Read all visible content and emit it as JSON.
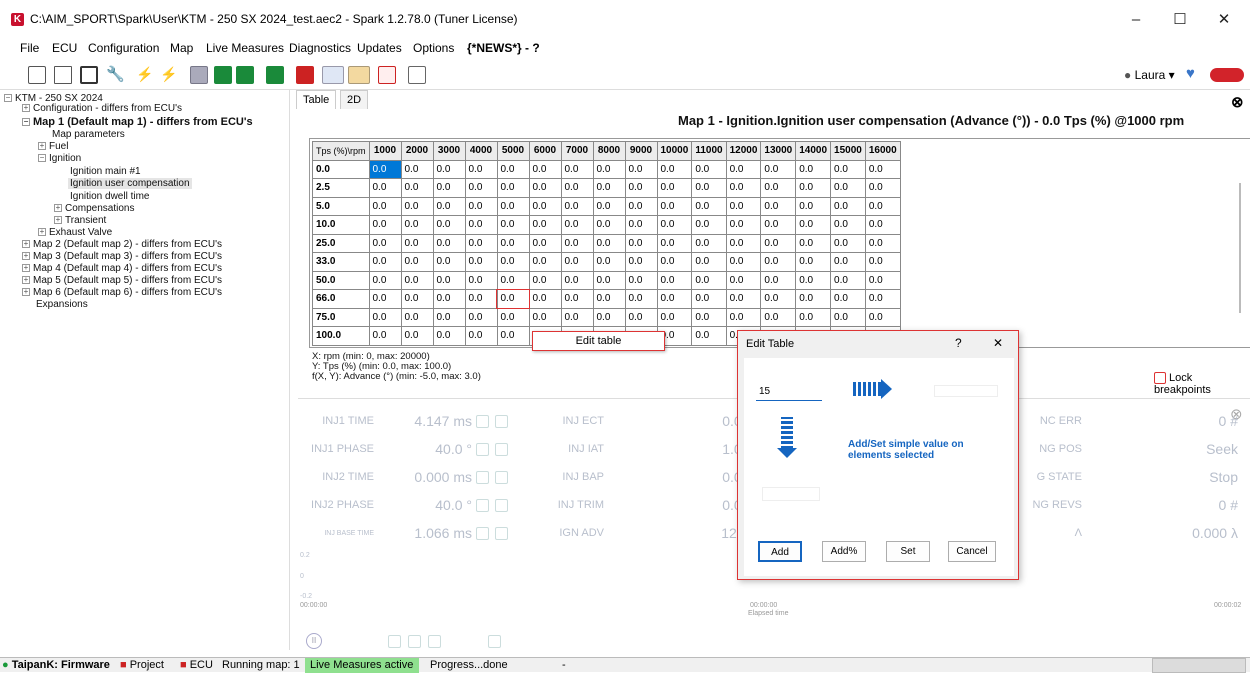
{
  "window": {
    "title": "C:\\AIM_SPORT\\Spark\\User\\KTM - 250 SX 2024_test.aec2 - Spark 1.2.78.0 (Tuner License)",
    "logo_letter": "K"
  },
  "menu": [
    "File",
    "ECU",
    "Configuration",
    "Map",
    "Live Measures",
    "Diagnostics",
    "Updates",
    "Options",
    "{*NEWS*} - ?"
  ],
  "user": {
    "name": "Laura"
  },
  "tree": [
    {
      "label": "KTM - 250 SX 2024",
      "expander": "−",
      "bold": false
    },
    {
      "label": "Configuration - differs from ECU's",
      "expander": "+",
      "bold": false
    },
    {
      "label": "Map 1 (Default map 1) - differs from ECU's",
      "expander": "−",
      "bold": true
    },
    {
      "label": "Map parameters",
      "expander": "",
      "bold": false
    },
    {
      "label": "Fuel",
      "expander": "+",
      "bold": false
    },
    {
      "label": "Ignition",
      "expander": "−",
      "bold": false
    },
    {
      "label": "Ignition main #1",
      "expander": "",
      "bold": false
    },
    {
      "label": "Ignition user compensation",
      "expander": "",
      "bold": false
    },
    {
      "label": "Ignition dwell time",
      "expander": "",
      "bold": false
    },
    {
      "label": "Compensations",
      "expander": "+",
      "bold": false
    },
    {
      "label": "Transient",
      "expander": "+",
      "bold": false
    },
    {
      "label": "Exhaust Valve",
      "expander": "+",
      "bold": false
    },
    {
      "label": "Map 2 (Default map 2) - differs from ECU's",
      "expander": "+",
      "bold": false
    },
    {
      "label": "Map 3 (Default map 3) - differs from ECU's",
      "expander": "+",
      "bold": false
    },
    {
      "label": "Map 4 (Default map 4) - differs from ECU's",
      "expander": "+",
      "bold": false
    },
    {
      "label": "Map 5 (Default map 5) - differs from ECU's",
      "expander": "+",
      "bold": false
    },
    {
      "label": "Map 6 (Default map 6) - differs from ECU's",
      "expander": "+",
      "bold": false
    },
    {
      "label": "Expansions",
      "expander": "",
      "bold": false
    }
  ],
  "tabs": [
    "Table",
    "2D"
  ],
  "map_title": "Map 1  -  Ignition.Ignition user compensation (Advance (°))  -  0.0 Tps (%) @1000 rpm",
  "table": {
    "corner": "Tps (%)\\rpm",
    "columns": [
      "1000",
      "2000",
      "3000",
      "4000",
      "5000",
      "6000",
      "7000",
      "8000",
      "9000",
      "10000",
      "11000",
      "12000",
      "13000",
      "14000",
      "15000",
      "16000"
    ],
    "rows": [
      {
        "label": "0.0",
        "cells": [
          "0.0",
          "0.0",
          "0.0",
          "0.0",
          "0.0",
          "0.0",
          "0.0",
          "0.0",
          "0.0",
          "0.0",
          "0.0",
          "0.0",
          "0.0",
          "0.0",
          "0.0",
          "0.0"
        ]
      },
      {
        "label": "2.5",
        "cells": [
          "0.0",
          "0.0",
          "0.0",
          "0.0",
          "0.0",
          "0.0",
          "0.0",
          "0.0",
          "0.0",
          "0.0",
          "0.0",
          "0.0",
          "0.0",
          "0.0",
          "0.0",
          "0.0"
        ]
      },
      {
        "label": "5.0",
        "cells": [
          "0.0",
          "0.0",
          "0.0",
          "0.0",
          "0.0",
          "0.0",
          "0.0",
          "0.0",
          "0.0",
          "0.0",
          "0.0",
          "0.0",
          "0.0",
          "0.0",
          "0.0",
          "0.0"
        ]
      },
      {
        "label": "10.0",
        "cells": [
          "0.0",
          "0.0",
          "0.0",
          "0.0",
          "0.0",
          "0.0",
          "0.0",
          "0.0",
          "0.0",
          "0.0",
          "0.0",
          "0.0",
          "0.0",
          "0.0",
          "0.0",
          "0.0"
        ]
      },
      {
        "label": "25.0",
        "cells": [
          "0.0",
          "0.0",
          "0.0",
          "0.0",
          "0.0",
          "0.0",
          "0.0",
          "0.0",
          "0.0",
          "0.0",
          "0.0",
          "0.0",
          "0.0",
          "0.0",
          "0.0",
          "0.0"
        ]
      },
      {
        "label": "33.0",
        "cells": [
          "0.0",
          "0.0",
          "0.0",
          "0.0",
          "0.0",
          "0.0",
          "0.0",
          "0.0",
          "0.0",
          "0.0",
          "0.0",
          "0.0",
          "0.0",
          "0.0",
          "0.0",
          "0.0"
        ]
      },
      {
        "label": "50.0",
        "cells": [
          "0.0",
          "0.0",
          "0.0",
          "0.0",
          "0.0",
          "0.0",
          "0.0",
          "0.0",
          "0.0",
          "0.0",
          "0.0",
          "0.0",
          "0.0",
          "0.0",
          "0.0",
          "0.0"
        ]
      },
      {
        "label": "66.0",
        "cells": [
          "0.0",
          "0.0",
          "0.0",
          "0.0",
          "0.0",
          "0.0",
          "0.0",
          "0.0",
          "0.0",
          "0.0",
          "0.0",
          "0.0",
          "0.0",
          "0.0",
          "0.0",
          "0.0"
        ]
      },
      {
        "label": "75.0",
        "cells": [
          "0.0",
          "0.0",
          "0.0",
          "0.0",
          "0.0",
          "0.0",
          "0.0",
          "0.0",
          "0.0",
          "0.0",
          "0.0",
          "0.0",
          "0.0",
          "0.0",
          "0.0",
          "0.0"
        ]
      },
      {
        "label": "100.0",
        "cells": [
          "0.0",
          "0.0",
          "0.0",
          "0.0",
          "0.0",
          "0.0",
          "0.0",
          "0.0",
          "0.0",
          "0.0",
          "0.0",
          "0.0",
          "0.0",
          "0.0",
          "0.0",
          "0.0"
        ]
      }
    ],
    "selected_color": "#0078d7"
  },
  "axis_info": [
    "X: rpm (min: 0, max: 20000)",
    "Y: Tps (%) (min: 0.0, max: 100.0)",
    "f(X, Y): Advance (°) (min: -5.0, max: 3.0)"
  ],
  "lock_breakpoints": "Lock breakpoints",
  "context_menu": {
    "item": "Edit table"
  },
  "edit_dialog": {
    "title": "Edit Table",
    "help": "?",
    "close": "✕",
    "value": "15",
    "hint": "Add/Set simple value on elements selected",
    "buttons": [
      "Add",
      "Add%",
      "Set",
      "Cancel"
    ],
    "accent": "#1565c0"
  },
  "live": {
    "left": [
      {
        "name": "INJ1 TIME",
        "value": "4.147 ms"
      },
      {
        "name": "INJ1 PHASE",
        "value": "40.0 °"
      },
      {
        "name": "INJ2 TIME",
        "value": "0.000 ms"
      },
      {
        "name": "INJ2 PHASE",
        "value": "40.0 °"
      },
      {
        "name": "INJ BASE TIME",
        "value": "1.066 ms"
      }
    ],
    "mid": [
      {
        "name": "INJ ECT",
        "value": "0.0 %"
      },
      {
        "name": "INJ IAT",
        "value": "1.0 %"
      },
      {
        "name": "INJ BAP",
        "value": "0.0 %"
      },
      {
        "name": "INJ TRIM",
        "value": "0.0 %"
      },
      {
        "name": "IGN ADV",
        "value": "12.0 °"
      }
    ],
    "right": [
      {
        "name": "NC ERR",
        "value": "0 #"
      },
      {
        "name": "NG POS",
        "value": "Seek"
      },
      {
        "name": "G STATE",
        "value": "Stop"
      },
      {
        "name": "NG REVS",
        "value": "0 #"
      },
      {
        "name": "Λ",
        "value": "0.000 λ"
      }
    ],
    "plot_ticks": [
      "0.2",
      "0",
      "-0.2"
    ],
    "time_left": "00:00:00",
    "time_mid": "00:00:00",
    "time_label": "Elapsed time",
    "time_right": "00:00:02"
  },
  "status": {
    "firmware": "TaipanK: Firmware",
    "project": "Project",
    "ecu": "ECU",
    "running": "Running map: 1",
    "live": "Live Measures active",
    "progress": "Progress...done",
    "dash": "-"
  }
}
